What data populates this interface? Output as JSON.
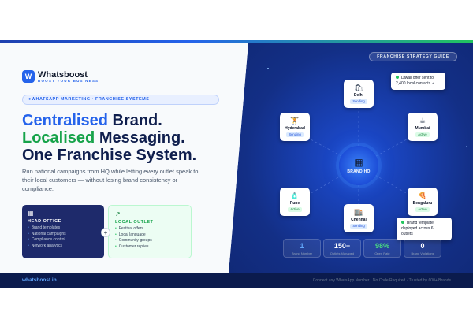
{
  "brand": {
    "mark": "W",
    "name": "Whatsboost",
    "tagline": "BOOST YOUR BUSINESS"
  },
  "category_pill": "●WHATSAPP MARKETING · FRANCHISE SYSTEMS",
  "headline": {
    "line1_accent": "Centralised",
    "line1_rest": " Brand.",
    "line2_accent": "Localised",
    "line2_rest": " Messaging.",
    "line3": "One Franchise System."
  },
  "subtext": "Run national campaigns from HQ while letting every outlet speak to their local customers — without losing brand consistency or compliance.",
  "head_office": {
    "icon": "building-icon",
    "title": "HEAD OFFICE",
    "items": [
      "Brand templates",
      "National campaigns",
      "Compliance control",
      "Network analytics"
    ]
  },
  "local_outlet": {
    "icon": "pin-icon",
    "title": "LOCAL OUTLET",
    "items": [
      "Festival offers",
      "Local language",
      "Community groups",
      "Customer replies"
    ]
  },
  "plus_glyph": "+",
  "guide_label": "FRANCHISE STRATEGY GUIDE",
  "hub": {
    "label": "BRAND HQ"
  },
  "nodes": [
    {
      "id": "delhi",
      "name": "Delhi",
      "status": "Sending",
      "status_kind": "sending",
      "icon": "bag-icon"
    },
    {
      "id": "mumbai",
      "name": "Mumbai",
      "status": "Active",
      "status_kind": "active",
      "icon": "coffee-icon"
    },
    {
      "id": "bengaluru",
      "name": "Bengaluru",
      "status": "Active",
      "status_kind": "active",
      "icon": "pizza-icon"
    },
    {
      "id": "chennai",
      "name": "Chennai",
      "status": "Sending",
      "status_kind": "sending",
      "icon": "store-icon"
    },
    {
      "id": "pune",
      "name": "Pune",
      "status": "Active",
      "status_kind": "active",
      "icon": "bottle-icon"
    },
    {
      "id": "hyderabad",
      "name": "Hyderabad",
      "status": "Sending",
      "status_kind": "sending",
      "icon": "dumbbell-icon"
    }
  ],
  "toasts": {
    "diwali": {
      "line1": "Diwali offer sent to",
      "line2": "2,400 local contacts ✓"
    },
    "template": {
      "line1": "Brand template",
      "line2": "deployed across 6",
      "line3": "outlets"
    }
  },
  "stats": [
    {
      "value": "1",
      "label": "Brand Number",
      "color": "#60a5fa"
    },
    {
      "value": "150+",
      "label": "Outlets Managed",
      "color": "#ffffff"
    },
    {
      "value": "98%",
      "label": "Open Rate",
      "color": "#4ade80"
    },
    {
      "value": "0",
      "label": "Brand Violations",
      "color": "#ffffff"
    }
  ],
  "footer": {
    "brand": "whatsboost.in",
    "note": "Connect any WhatsApp Number · No Code Required · Trusted by 600+ Brands"
  },
  "colors": {
    "accent": "#2563eb",
    "green": "#16a34a",
    "navy": "#0f1e4d"
  }
}
